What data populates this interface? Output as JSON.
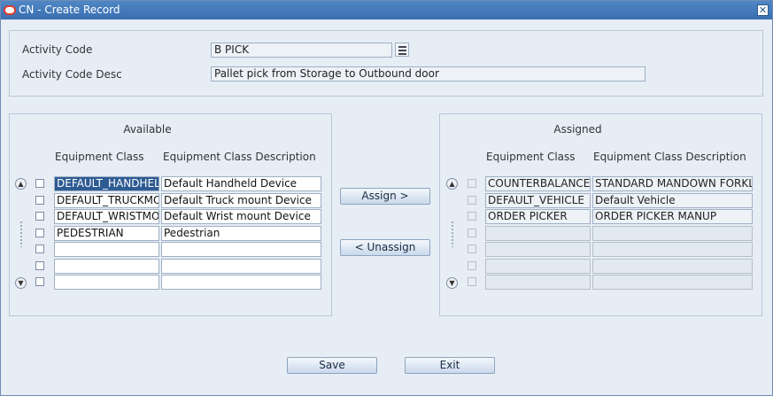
{
  "window": {
    "title": "CN - Create Record",
    "close_glyph": "✕"
  },
  "form": {
    "activity_code_label": "Activity Code",
    "activity_code_value": "B PICK",
    "activity_code_desc_label": "Activity Code Desc",
    "activity_code_desc_value": "Pallet pick from Storage to Outbound door"
  },
  "available": {
    "title": "Available",
    "col1": "Equipment Class",
    "col2": "Equipment Class Description",
    "rows": [
      {
        "cls": "DEFAULT_HANDHELD",
        "desc": "Default Handheld Device"
      },
      {
        "cls": "DEFAULT_TRUCKMOUNT",
        "desc": "Default Truck mount Device"
      },
      {
        "cls": "DEFAULT_WRISTMOUNT",
        "desc": "Default Wrist mount Device"
      },
      {
        "cls": "PEDESTRIAN",
        "desc": "Pedestrian"
      },
      {
        "cls": "",
        "desc": ""
      },
      {
        "cls": "",
        "desc": ""
      },
      {
        "cls": "",
        "desc": ""
      }
    ]
  },
  "assigned": {
    "title": "Assigned",
    "col1": "Equipment Class",
    "col2": "Equipment Class Description",
    "rows": [
      {
        "cls": "COUNTERBALANCE",
        "desc": "STANDARD MANDOWN FORKLIFT"
      },
      {
        "cls": "DEFAULT_VEHICLE",
        "desc": "Default Vehicle"
      },
      {
        "cls": "ORDER PICKER",
        "desc": "ORDER PICKER MANUP"
      },
      {
        "cls": "",
        "desc": ""
      },
      {
        "cls": "",
        "desc": ""
      },
      {
        "cls": "",
        "desc": ""
      },
      {
        "cls": "",
        "desc": ""
      }
    ]
  },
  "buttons": {
    "assign": "Assign >",
    "unassign": "< Unassign",
    "save": "Save",
    "exit": "Exit"
  },
  "scroll": {
    "up": "▲",
    "down": "▼"
  },
  "colors": {
    "title_bar": "#3a6fb0",
    "selection": "#2e5b93",
    "background": "#e6edf5"
  }
}
